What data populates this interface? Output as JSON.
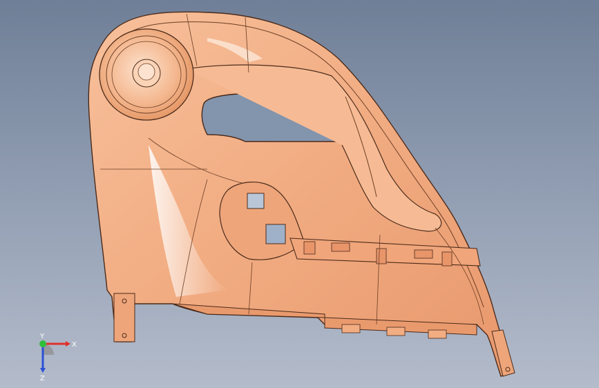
{
  "viewport": {
    "background_top": "#6f7f97",
    "background_bottom": "#b4bccb"
  },
  "model": {
    "part_name": "door-trim-panel",
    "surface_color": "#f2ad83",
    "highlight_color": "#fde3cf",
    "edge_color": "#4a2a1a",
    "insert_color": "#9eb1c9"
  },
  "triad": {
    "x_label": "X",
    "y_label": "Y",
    "z_label": "Z",
    "x_color": "#e0312b",
    "y_color": "#2fbf3b",
    "z_color": "#2b4fd6"
  }
}
